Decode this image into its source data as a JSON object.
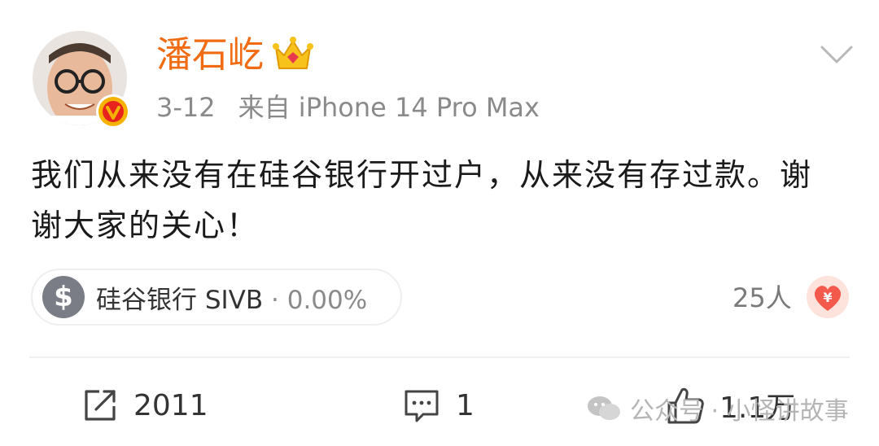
{
  "author": {
    "name": "潘石屹",
    "date": "3-12",
    "source": "来自 iPhone 14 Pro Max"
  },
  "post": {
    "text": "我们从来没有在硅谷银行开过户，从来没有存过款。谢谢大家的关心！"
  },
  "stock_chip": {
    "symbol_icon": "$",
    "name": "硅谷银行 SIVB",
    "separator": "·",
    "change": "0.00%"
  },
  "reward": {
    "count": "25人",
    "icon_glyph": "¥"
  },
  "actions": {
    "repost_count": "2011",
    "comment_count": "1",
    "like_count": "1.1万"
  },
  "watermark": {
    "text": "公众号 · 小怪讲故事"
  },
  "colors": {
    "username": "#f06b11",
    "meta": "#8a8a8a",
    "reward_heart": "#f35a4c"
  }
}
